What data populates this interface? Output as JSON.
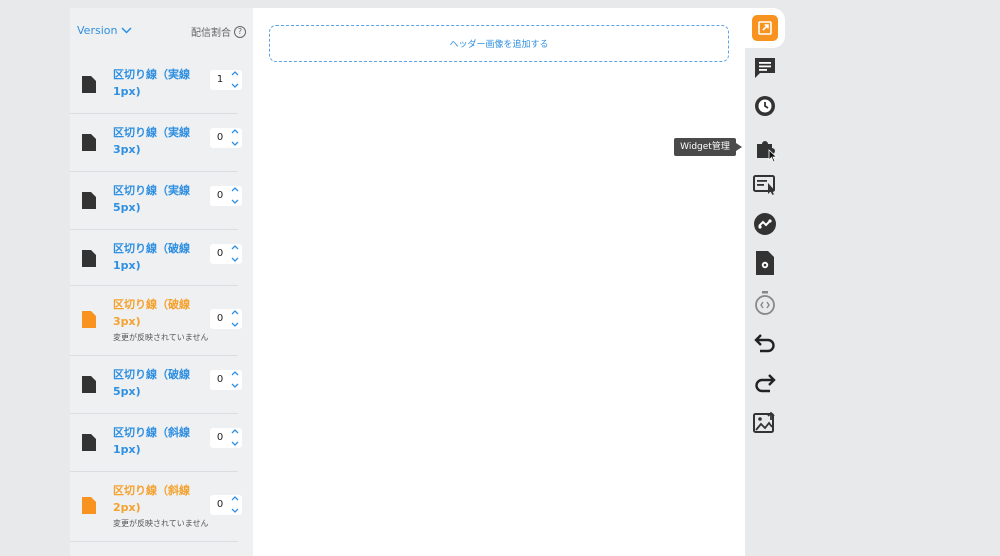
{
  "left_panel": {
    "version_label": "Version",
    "ratio_label": "配信割合",
    "help_glyph": "?",
    "items": [
      {
        "title": "区切り線（実線1px)",
        "value": "1",
        "warning": false,
        "note": ""
      },
      {
        "title": "区切り線（実線3px)",
        "value": "0",
        "warning": false,
        "note": ""
      },
      {
        "title": "区切り線（実線5px)",
        "value": "0",
        "warning": false,
        "note": ""
      },
      {
        "title": "区切り線（破線1px)",
        "value": "0",
        "warning": false,
        "note": ""
      },
      {
        "title": "区切り線（破線3px)",
        "value": "0",
        "warning": true,
        "note": "変更が反映されていません"
      },
      {
        "title": "区切り線（破線5px)",
        "value": "0",
        "warning": false,
        "note": ""
      },
      {
        "title": "区切り線（斜線1px)",
        "value": "0",
        "warning": false,
        "note": ""
      },
      {
        "title": "区切り線（斜線2px)",
        "value": "0",
        "warning": true,
        "note": "変更が反映されていません"
      }
    ]
  },
  "canvas": {
    "header_add_label": "ヘッダー画像を追加する"
  },
  "toolbar": {
    "tooltip": "Widget管理",
    "icons": [
      "open-external-icon",
      "comment-icon",
      "history-icon",
      "widget-puzzle-icon",
      "form-cursor-icon",
      "transfer-icon",
      "file-settings-icon",
      "stopwatch-code-icon",
      "undo-icon",
      "redo-icon",
      "image-upload-icon"
    ]
  },
  "colors": {
    "accent": "#2f8fe0",
    "warning": "#f4a12d",
    "orange_button": "#f7931e"
  }
}
